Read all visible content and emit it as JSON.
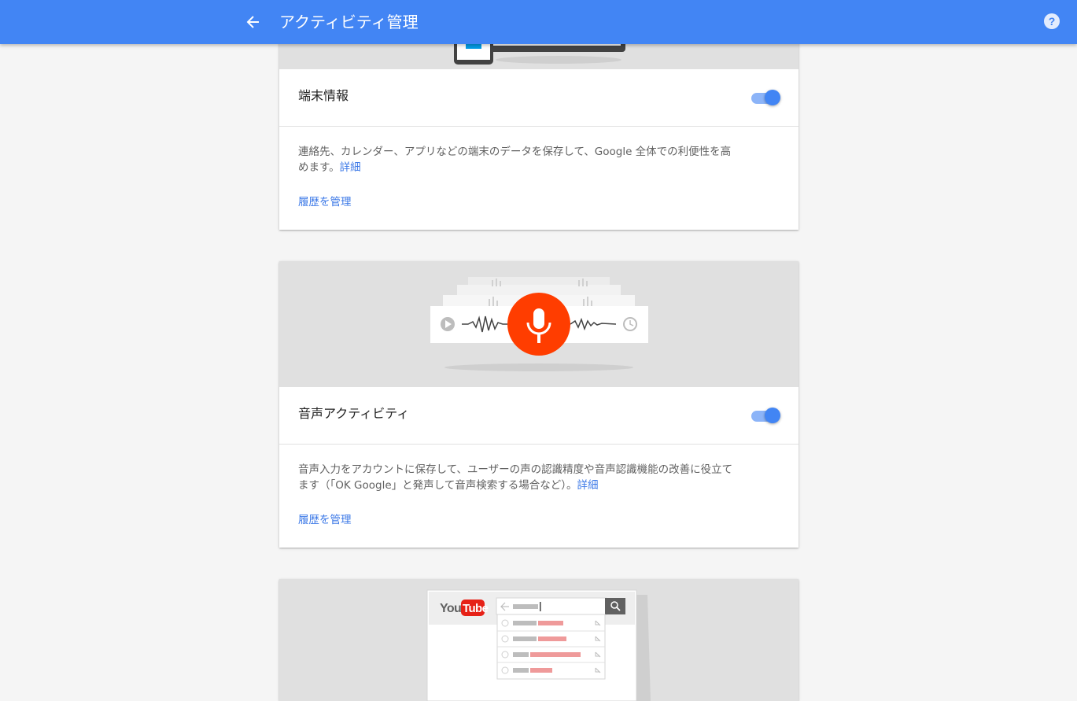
{
  "appbar": {
    "title": "アクティビティ管理",
    "back_icon": "arrow-back-icon",
    "help_icon": "help-icon",
    "color": "#4285f4"
  },
  "cards": [
    {
      "title": "端末情報",
      "toggle_on": true,
      "description": "連絡先、カレンダー、アプリなどの端末のデータを保存して、Google 全体での利便性を高めます。",
      "learn_more": "詳細",
      "manage_label": "履歴を管理"
    },
    {
      "title": "音声アクティビティ",
      "toggle_on": true,
      "description": "音声入力をアカウントに保存して、ユーザーの声の認識精度や音声認識機能の改善に役立てます（「OK Google」と発声して音声検索する場合など）。",
      "learn_more": "詳細",
      "manage_label": "履歴を管理",
      "mic_color": "#ff3d00"
    },
    {
      "illustration_logo": "YouTube"
    }
  ],
  "colors": {
    "accent": "#4285f4",
    "link": "#3b78e7",
    "toggle_track": "#8cb4f8"
  }
}
